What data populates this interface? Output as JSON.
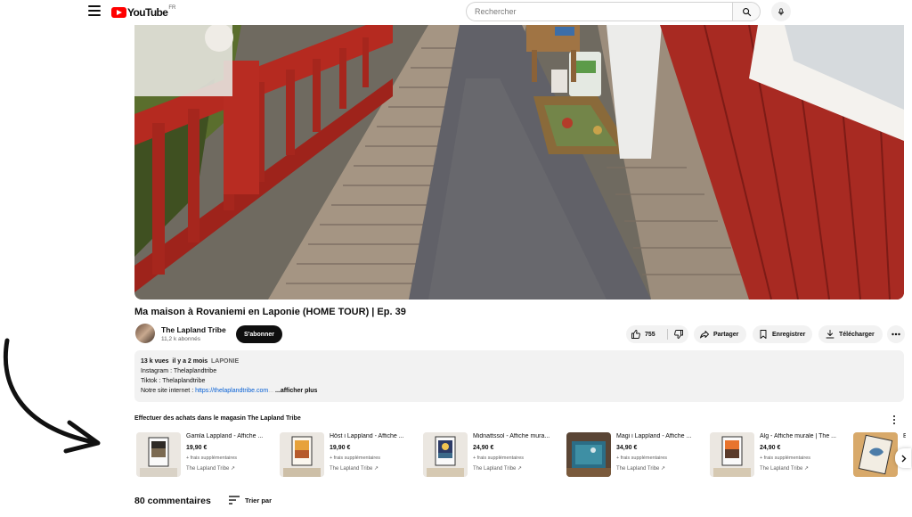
{
  "header": {
    "logo_text": "YouTube",
    "logo_country": "FR",
    "search_placeholder": "Rechercher",
    "icons": [
      "menu-icon",
      "search-icon",
      "microphone-icon"
    ]
  },
  "video": {
    "title": "Ma maison à Rovaniemi en Laponie (HOME TOUR) | Ep. 39",
    "channel_name": "The Lapland Tribe",
    "channel_subs": "11,2 k abonnés",
    "subscribe_label": "S'abonner",
    "like_count": "755",
    "share_label": "Partager",
    "save_label": "Enregistrer",
    "download_label": "Télécharger"
  },
  "description": {
    "views": "13 k vues",
    "date": "il y a 2 mois",
    "tag": "LAPONIE",
    "line_instagram": "Instagram : Thelaplandtribe",
    "line_tiktok": "Tiktok : Thelaplandtribe",
    "site_prefix": "Notre site internet : ",
    "site_link": "https://thelaplandtribe.com",
    "site_fade": "...",
    "show_more": "...afficher plus"
  },
  "shop": {
    "title": "Effectuer des achats dans le magasin The Lapland Tribe",
    "products": [
      {
        "name": "Gamla Lappland - Affiche ...",
        "price": "19,90 €",
        "shipping": "+ frais supplémentaires",
        "store": "The Lapland Tribe ↗"
      },
      {
        "name": "Höst i Lappland - Affiche ...",
        "price": "19,90 €",
        "shipping": "+ frais supplémentaires",
        "store": "The Lapland Tribe ↗"
      },
      {
        "name": "Midnattssol - Affiche mura...",
        "price": "24,90 €",
        "shipping": "+ frais supplémentaires",
        "store": "The Lapland Tribe ↗"
      },
      {
        "name": "Magi i Lappland - Affiche ...",
        "price": "34,90 €",
        "shipping": "+ frais supplémentaires",
        "store": "The Lapland Tribe ↗"
      },
      {
        "name": "Älg - Affiche murale | The ...",
        "price": "24,90 €",
        "shipping": "+ frais supplémentaires",
        "store": "The Lapland Tribe ↗"
      },
      {
        "name": "E",
        "price": "",
        "shipping": "",
        "store": ""
      }
    ]
  },
  "comments": {
    "count_label": "80 commentaires",
    "sort_label": "Trier par"
  },
  "colors": {
    "brand_red": "#ff0000",
    "link_blue": "#065fd4",
    "pill_bg": "#f2f2f2",
    "text_primary": "#0f0f0f",
    "text_secondary": "#606060"
  }
}
